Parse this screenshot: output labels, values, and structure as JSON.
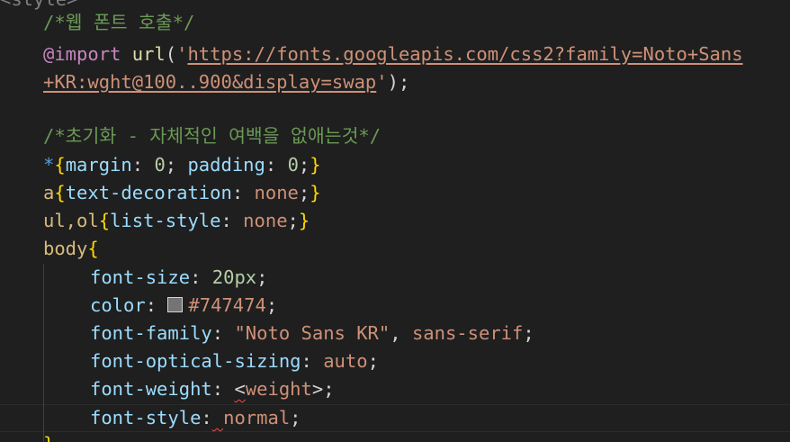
{
  "colors": {
    "background": "#1f1f1f",
    "comment": "#6a9955",
    "keyword": "#c586c0",
    "string": "#ce9178",
    "property": "#9cdcfe",
    "number": "#b5cea8",
    "brace": "#ffd700",
    "selector": "#d7ba7d",
    "swatch": "#747474"
  },
  "code": {
    "line0": {
      "tag": "<style>"
    },
    "line1": {
      "comment": "/*웹 폰트 호출*/"
    },
    "line2": {
      "at": "@import",
      "func": "url",
      "open": "(",
      "quote_open": "'",
      "url_part1": "https://fonts.googleapis.com/css2?family=Noto+Sans"
    },
    "line3": {
      "url_part2": "+KR:wght@100..900&display=swap",
      "quote_close": "'",
      "close": ");"
    },
    "line4": {
      "comment": "/*초기화 - 자체적인 여백을 없애는것*/"
    },
    "line5": {
      "star": "*",
      "brace_open": "{",
      "prop1": "margin",
      "colon1": ": ",
      "val1": "0",
      "semi1": "; ",
      "prop2": "padding",
      "colon2": ": ",
      "val2": "0",
      "semi2": ";",
      "brace_close": "}"
    },
    "line6": {
      "selector": "a",
      "brace_open": "{",
      "prop": "text-decoration",
      "colon": ": ",
      "val": "none",
      "semi": ";",
      "brace_close": "}"
    },
    "line7": {
      "selector": "ul,ol",
      "brace_open": "{",
      "prop": "list-style",
      "colon": ": ",
      "val": "none",
      "semi": ";",
      "brace_close": "}"
    },
    "line8": {
      "selector": "body",
      "brace_open": "{"
    },
    "line9": {
      "prop": "font-size",
      "colon": ": ",
      "val": "20px",
      "semi": ";"
    },
    "line10": {
      "prop": "color",
      "colon": ": ",
      "val": "#747474",
      "semi": ";"
    },
    "line11": {
      "prop": "font-family",
      "colon": ": ",
      "val1": "\"Noto Sans KR\"",
      "comma": ", ",
      "val2": "sans-serif",
      "semi": ";"
    },
    "line12": {
      "prop": "font-optical-sizing",
      "colon": ": ",
      "val": "auto",
      "semi": ";"
    },
    "line13": {
      "prop": "font-weight",
      "colon": ": ",
      "lt": "<",
      "val": "weight",
      "gt": ">",
      "semi": ";"
    },
    "line14": {
      "prop": "font-style",
      "colon": ":",
      "space": " ",
      "val": "normal",
      "semi": ";"
    },
    "line15": {
      "brace_close": "}"
    }
  }
}
